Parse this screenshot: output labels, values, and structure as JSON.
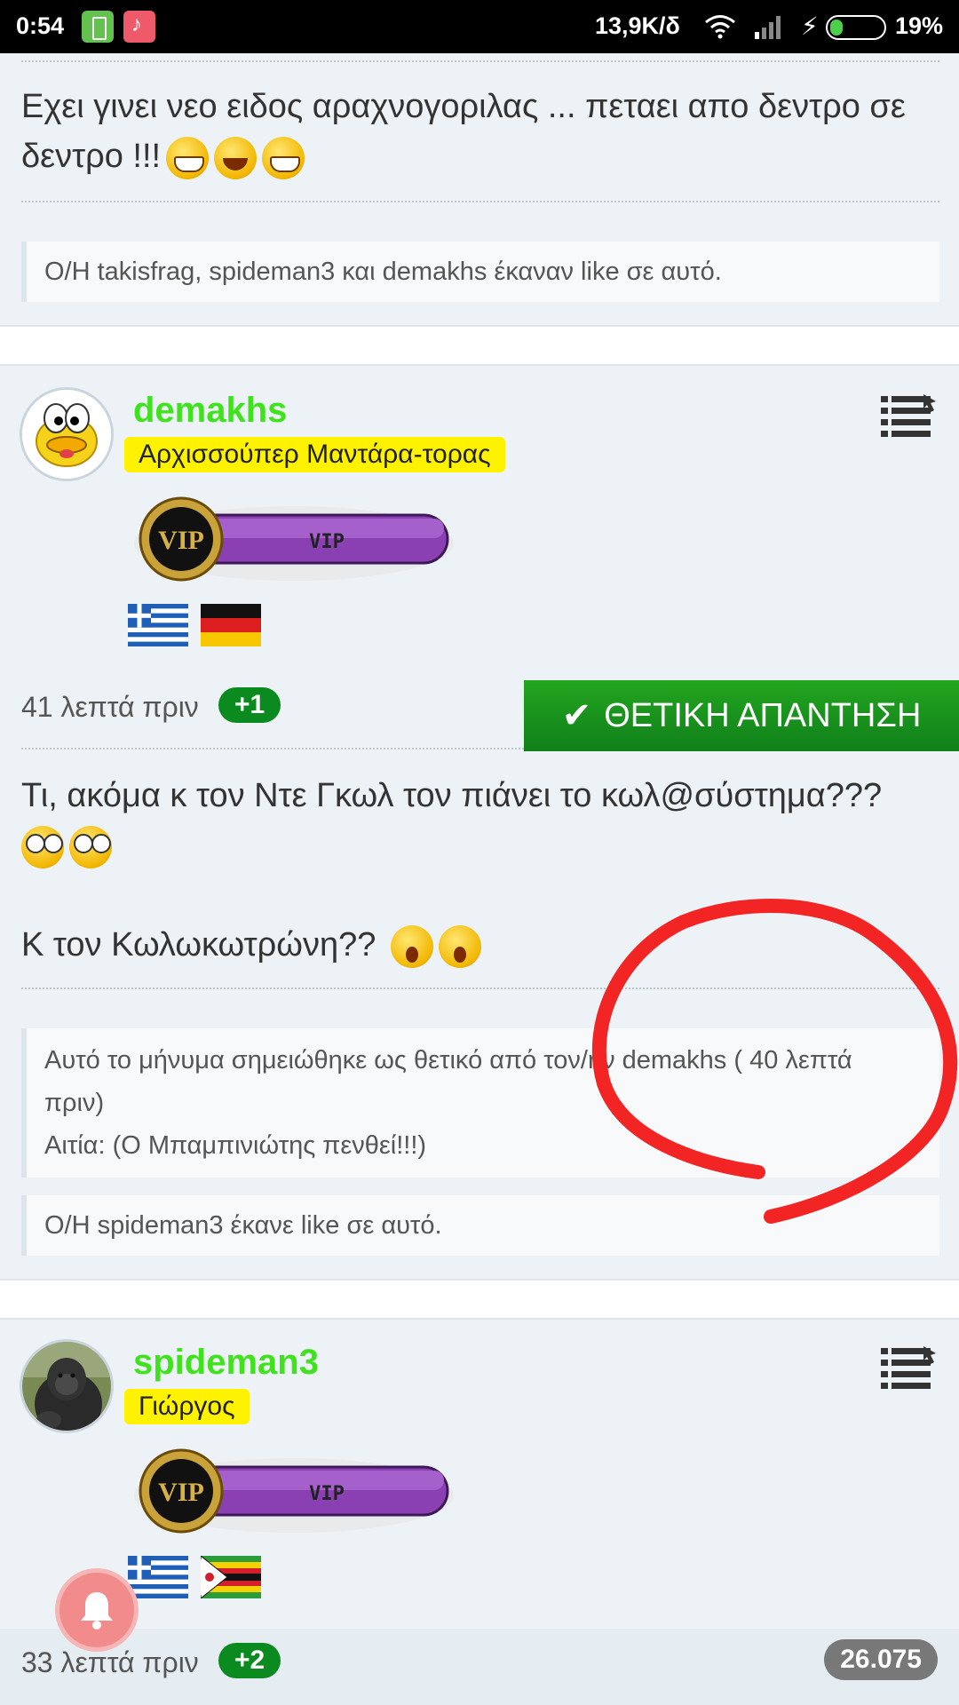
{
  "statusbar": {
    "time": "0:54",
    "network_speed": "13,9K/δ",
    "battery_percent": "19%",
    "icons": [
      "battery-app-icon",
      "music-app-icon",
      "wifi-icon",
      "signal-icon",
      "charging-icon",
      "battery-icon"
    ]
  },
  "post1": {
    "message": "Εχει γινει νεο ειδος αραχνογοριλας ... πεταει απο δεντρο σε δεντρο !!!",
    "emojis": [
      "grin",
      "tongue",
      "grin"
    ],
    "likes": "Ο/Η takisfrag, spideman3 και demakhs έκαναν like σε αυτό."
  },
  "post2": {
    "username": "demakhs",
    "user_title": "Αρχισσούπερ Μαντάρα-τορας",
    "vip_label": "VIP",
    "flags": [
      "greece",
      "germany"
    ],
    "time": "41 λεπτά πριν",
    "plus": "+1",
    "answer_button": "ΘΕΤΙΚΗ ΑΠΑΝΤΗΣΗ",
    "message_line1": "Τι, ακόμα κ τον Ντε Γκωλ τον πιάνει το κωλ@σύστημα???",
    "message_line2": "Κ τον Κωλωκωτρώνη??",
    "marked_note": "Αυτό το μήνυμα σημειώθηκε ως θετικό από τον/ην demakhs ( 40 λεπτά πριν)",
    "reason": "Αιτία: (Ο Μπαμπινιώτης πενθεί!!!)",
    "likes": "Ο/Η spideman3 έκανε like σε αυτό."
  },
  "post3": {
    "username": "spideman3",
    "user_title": "Γιώργος",
    "vip_label": "VIP",
    "flags": [
      "greece",
      "zimbabwe"
    ],
    "time": "33 λεπτά πριν",
    "plus": "+2",
    "score": "26.075"
  },
  "colors": {
    "username": "#3fe21d",
    "title_badge": "#fff200",
    "answer_green": "#13881b",
    "plus_green": "#0a8a1f",
    "annotation_red": "#f22424"
  }
}
